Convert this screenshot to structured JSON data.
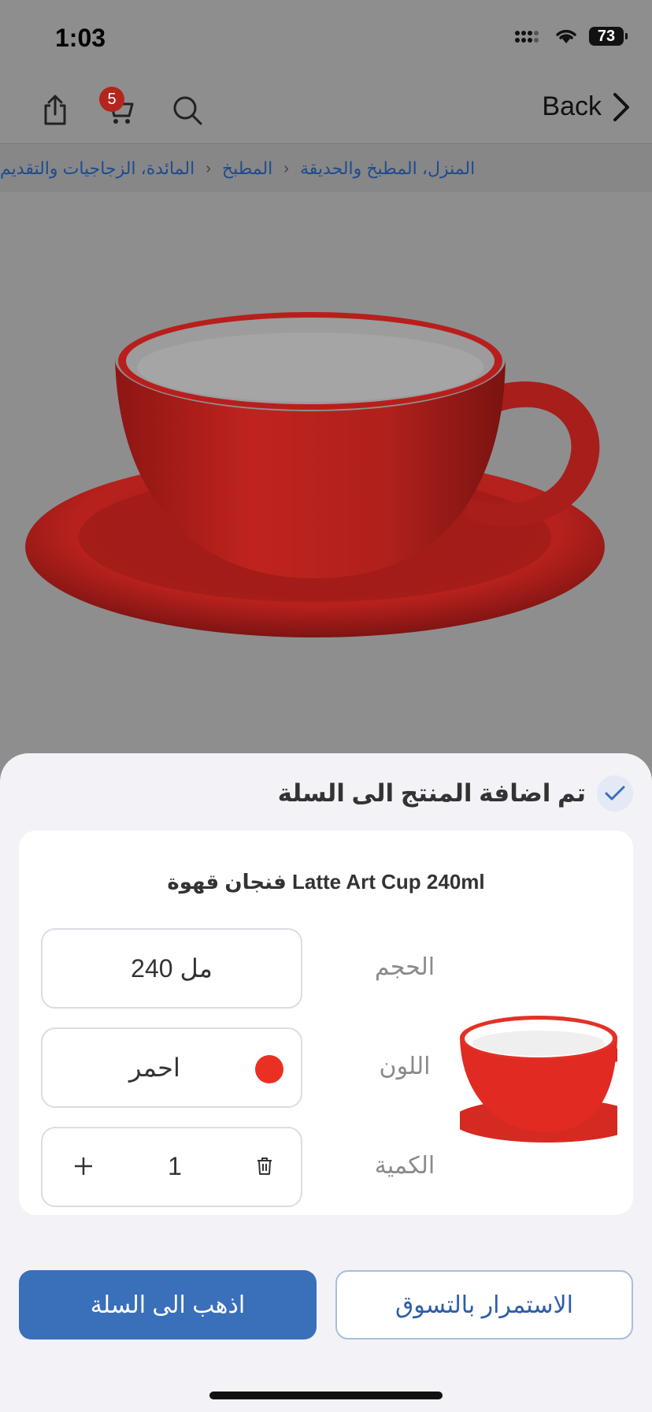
{
  "status": {
    "time": "1:03",
    "battery": "73"
  },
  "nav": {
    "back_label": "Back",
    "cart_count": "5"
  },
  "breadcrumb": [
    "المنزل، المطبخ والحديقة",
    "المطبخ",
    "المائدة، الزجاجيات والتقديم"
  ],
  "sheet": {
    "title": "تم اضافة المنتج الى السلة",
    "product_name": "فنجان قهوة Latte Art Cup 240ml",
    "size_label": "الحجم",
    "size_value": "240 مل",
    "color_label": "اللون",
    "color_value": "احمر",
    "color_swatch": "#ea2f23",
    "quantity_label": "الكمية",
    "quantity_value": "1"
  },
  "buttons": {
    "go_to_cart": "اذهب الى السلة",
    "continue_shopping": "الاستمرار بالتسوق"
  },
  "colors": {
    "accent": "#3a6fba",
    "badge": "#b3261e",
    "link": "#1f4b8f"
  }
}
